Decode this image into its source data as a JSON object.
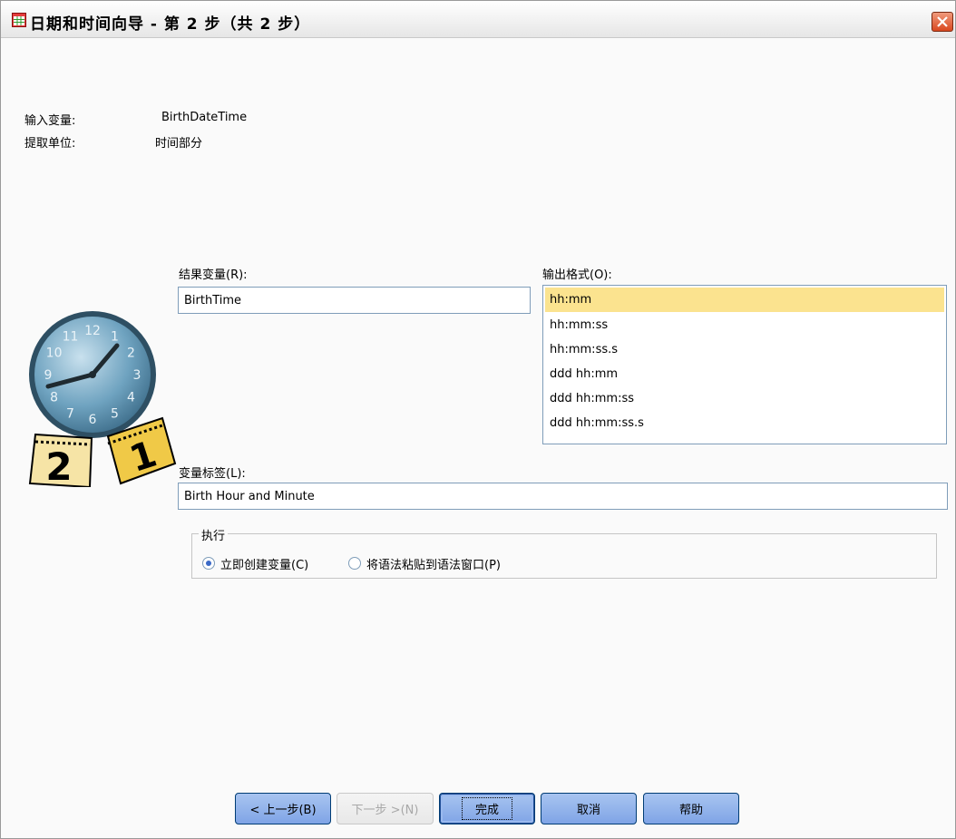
{
  "window": {
    "title": "日期和时间向导 - 第 2 步（共 2 步）"
  },
  "info": {
    "input_variable_label": "输入变量:",
    "input_variable_value": "BirthDateTime",
    "extract_unit_label": "提取单位:",
    "extract_unit_value": "时间部分"
  },
  "result_variable": {
    "label": "结果变量(R):",
    "value": "BirthTime"
  },
  "output_format": {
    "label": "输出格式(O):",
    "options": [
      "hh:mm",
      "hh:mm:ss",
      "hh:mm:ss.s",
      "ddd hh:mm",
      "ddd hh:mm:ss",
      "ddd hh:mm:ss.s"
    ],
    "selected_index": 0
  },
  "variable_label": {
    "label": "变量标签(L):",
    "value": "Birth Hour and Minute"
  },
  "execute": {
    "title": "执行",
    "option_create_now": "立即创建变量(C)",
    "option_paste_syntax": "将语法粘贴到语法窗口(P)",
    "selected": "option_create_now"
  },
  "buttons": {
    "back": "< 上一步(B)",
    "next": "下一步 >(N)",
    "finish": "完成",
    "cancel": "取消",
    "help": "帮助"
  },
  "clock_illustration": {
    "numbers": [
      "12",
      "1",
      "2",
      "3",
      "4",
      "5",
      "6",
      "7",
      "8",
      "9",
      "10",
      "11"
    ],
    "calendar_pages": [
      "2",
      "1"
    ]
  },
  "colors": {
    "selection_highlight": "#fbe38f",
    "button_blue": "#8fb0ea",
    "close_red": "#d9481f"
  }
}
